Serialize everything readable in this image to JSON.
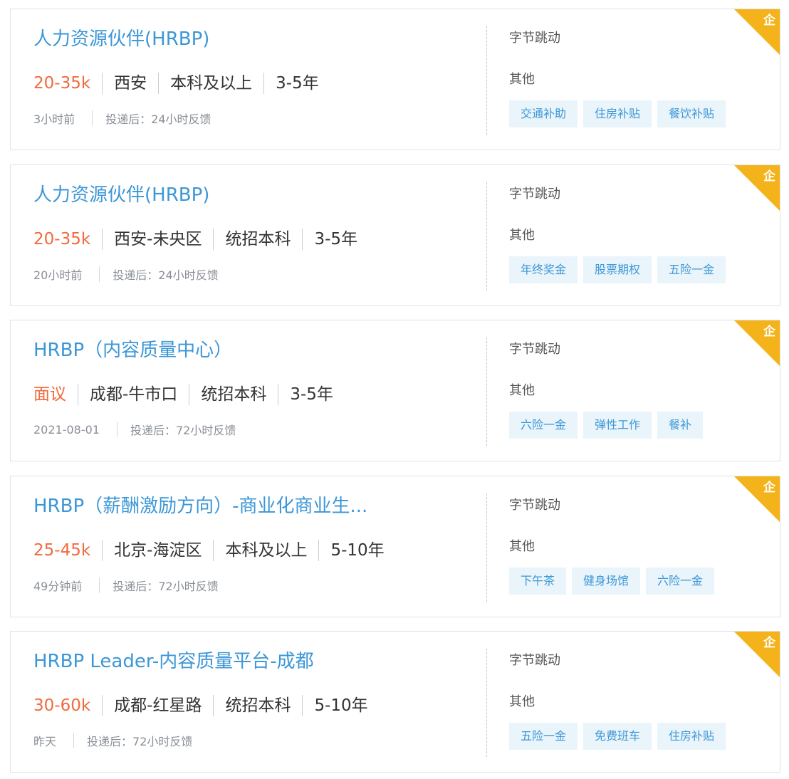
{
  "jobs": [
    {
      "title": "人力资源伙伴(HRBP)",
      "salary": "20-35k",
      "location": "西安",
      "education": "本科及以上",
      "experience": "3-5年",
      "posted": "3小时前",
      "feedback": "投递后：24小时反馈",
      "company": "字节跳动",
      "industry": "其他",
      "tags": [
        "交通补助",
        "住房补贴",
        "餐饮补贴"
      ],
      "badge": "企"
    },
    {
      "title": "人力资源伙伴(HRBP)",
      "salary": "20-35k",
      "location": "西安-未央区",
      "education": "统招本科",
      "experience": "3-5年",
      "posted": "20小时前",
      "feedback": "投递后：24小时反馈",
      "company": "字节跳动",
      "industry": "其他",
      "tags": [
        "年终奖金",
        "股票期权",
        "五险一金"
      ],
      "badge": "企"
    },
    {
      "title": "HRBP（内容质量中心）",
      "salary": "面议",
      "location": "成都-牛市口",
      "education": "统招本科",
      "experience": "3-5年",
      "posted": "2021-08-01",
      "feedback": "投递后：72小时反馈",
      "company": "字节跳动",
      "industry": "其他",
      "tags": [
        "六险一金",
        "弹性工作",
        "餐补"
      ],
      "badge": "企"
    },
    {
      "title": "HRBP（薪酬激励方向）-商业化商业生...",
      "salary": "25-45k",
      "location": "北京-海淀区",
      "education": "本科及以上",
      "experience": "5-10年",
      "posted": "49分钟前",
      "feedback": "投递后：72小时反馈",
      "company": "字节跳动",
      "industry": "其他",
      "tags": [
        "下午茶",
        "健身场馆",
        "六险一金"
      ],
      "badge": "企"
    },
    {
      "title": "HRBP Leader-内容质量平台-成都",
      "salary": "30-60k",
      "location": "成都-红星路",
      "education": "统招本科",
      "experience": "5-10年",
      "posted": "昨天",
      "feedback": "投递后：72小时反馈",
      "company": "字节跳动",
      "industry": "其他",
      "tags": [
        "五险一金",
        "免费班车",
        "住房补贴"
      ],
      "badge": "企"
    }
  ],
  "colors": {
    "title": "#3c97d6",
    "salary": "#f26a3d",
    "tag_bg": "#eaf4fb",
    "badge": "#f5b31b"
  }
}
